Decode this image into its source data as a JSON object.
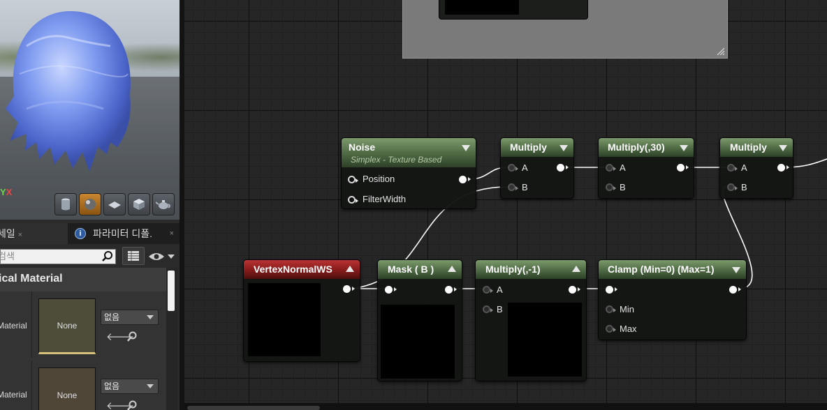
{
  "viewport": {
    "axis_labels": [
      "Y",
      "X"
    ],
    "buttons": [
      "cylinder-preview",
      "sphere-preview",
      "plane-preview",
      "cube-preview",
      "custom-mesh-preview"
    ]
  },
  "tabs": [
    {
      "label": "세일",
      "close": "×"
    },
    {
      "label": "파라미터 디폴.",
      "close": "×"
    }
  ],
  "search": {
    "placeholder": "검색"
  },
  "section": {
    "title": "ical Material"
  },
  "params": [
    {
      "name": "Material",
      "thumb": "None",
      "combo": "없음"
    },
    {
      "name": "Material",
      "thumb": "None",
      "combo": "없음"
    }
  ],
  "nodes": {
    "noise": {
      "title": "Noise",
      "subtitle": "Simplex - Texture Based",
      "pins": [
        "Position",
        "FilterWidth"
      ]
    },
    "mul1": {
      "title": "Multiply",
      "pins": [
        "A",
        "B"
      ]
    },
    "mul30": {
      "title": "Multiply(,30)",
      "pins": [
        "A",
        "B"
      ]
    },
    "mul3": {
      "title": "Multiply",
      "pins": [
        "A",
        "B"
      ]
    },
    "vnorm": {
      "title": "VertexNormalWS"
    },
    "mask": {
      "title": "Mask ( B )"
    },
    "mulneg": {
      "title": "Multiply(,-1)",
      "pins": [
        "A",
        "B"
      ]
    },
    "clamp": {
      "title": "Clamp (Min=0) (Max=1)",
      "pins": [
        "Min",
        "Max"
      ]
    }
  },
  "colors": {
    "graph_bg": "#262626",
    "node_header_green": "#55724a",
    "node_header_red": "#8a1c1c",
    "comment_bg": "#7a7a7a",
    "active_preview_button": "#c8862f"
  }
}
